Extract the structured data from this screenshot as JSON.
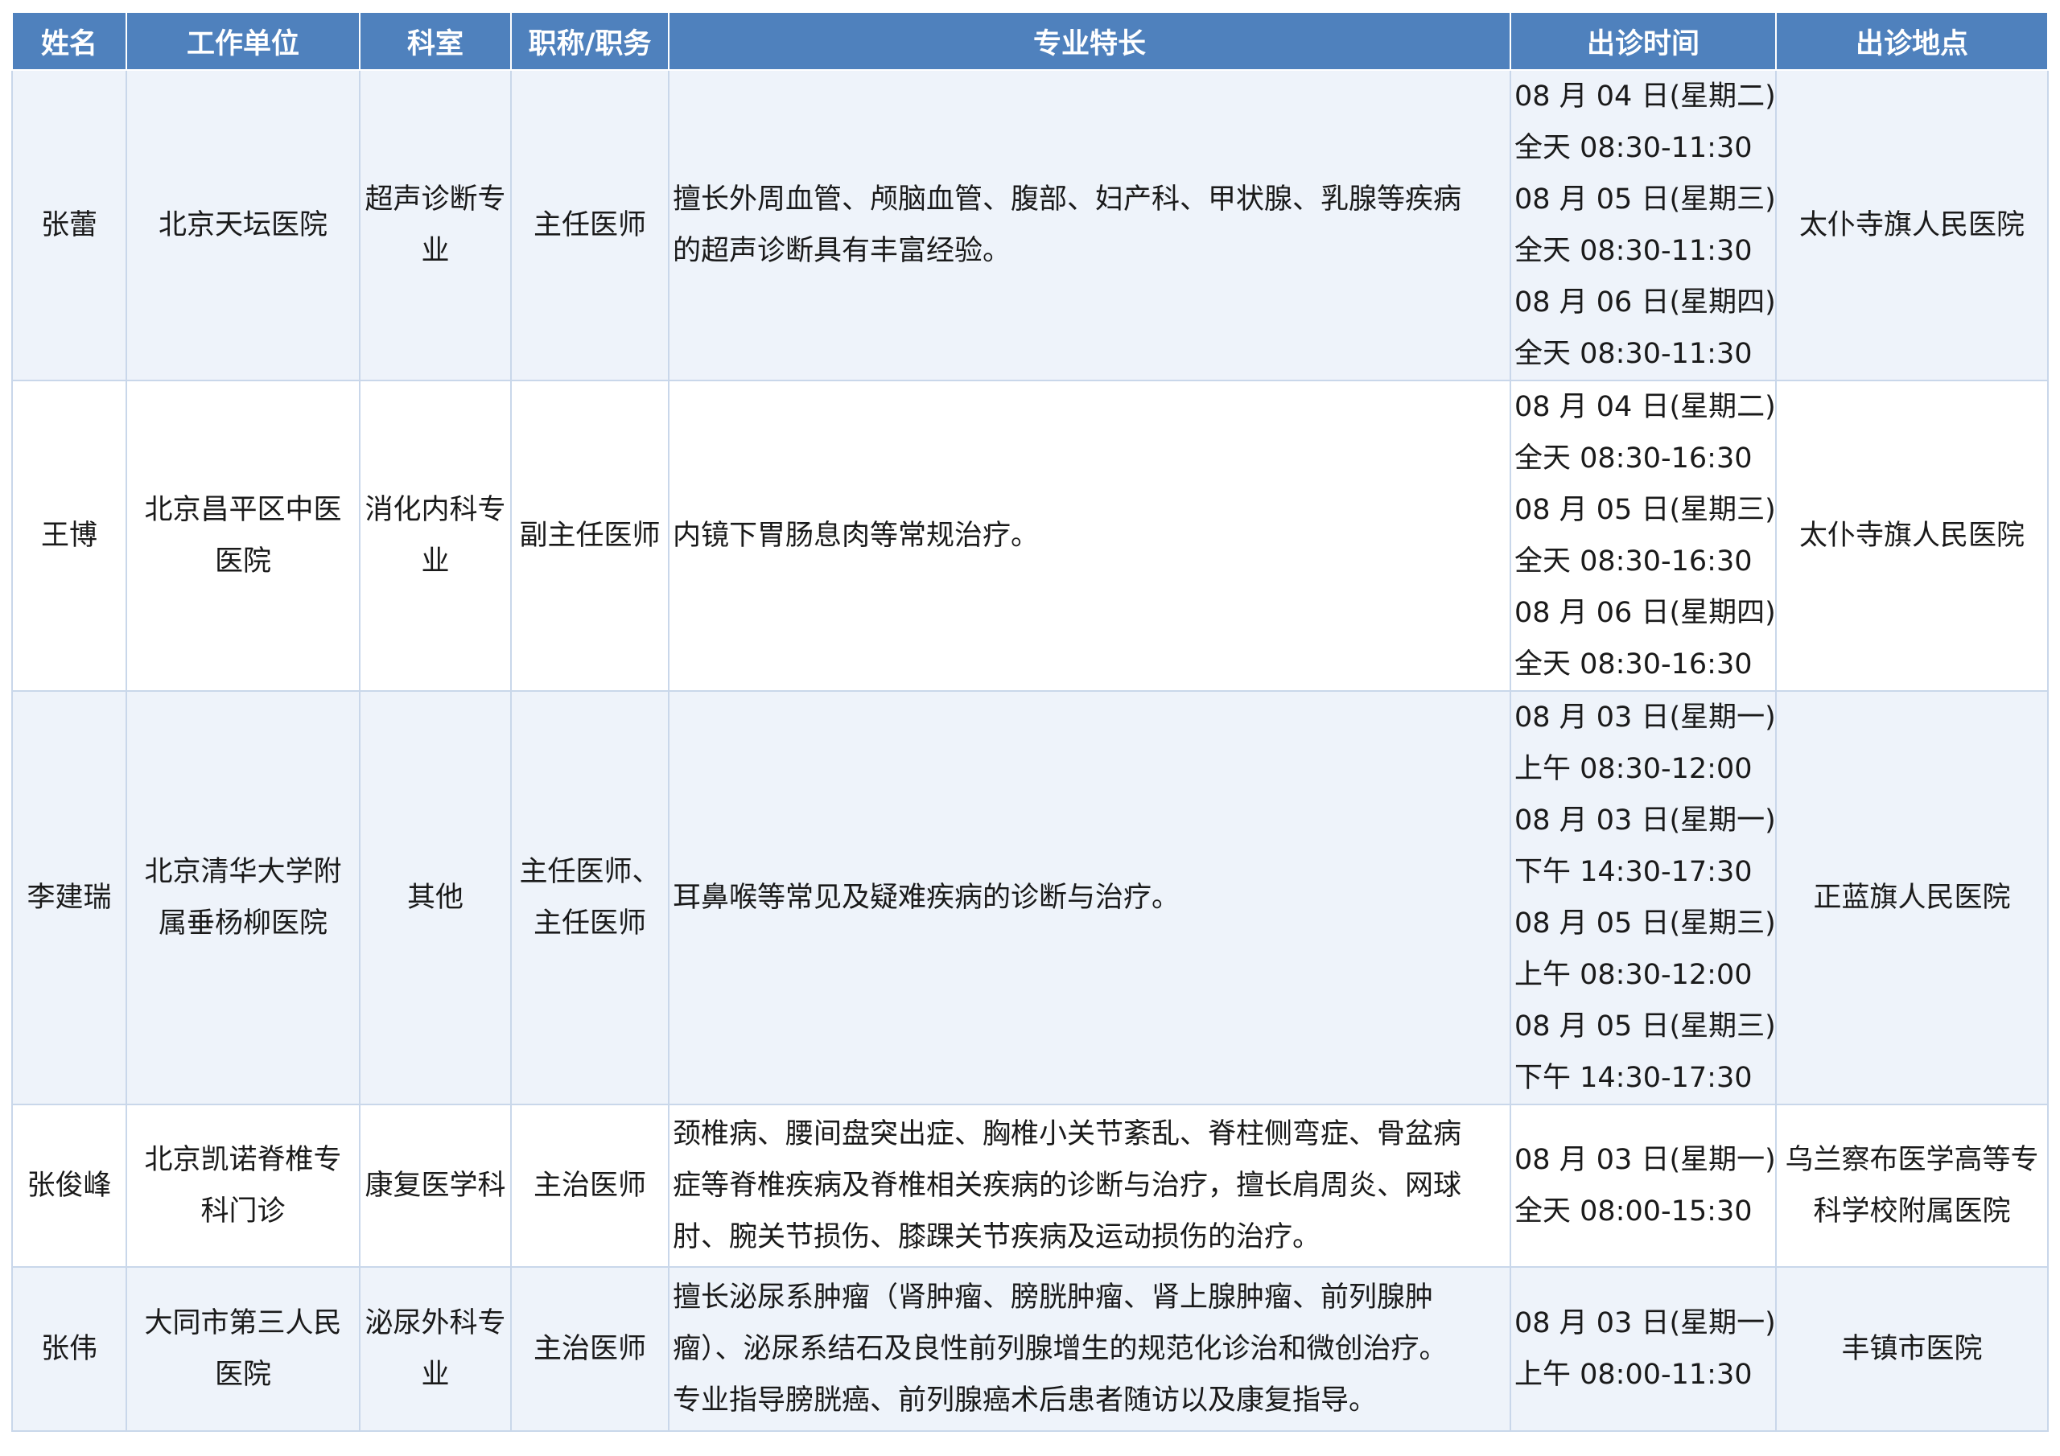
{
  "headers": [
    "姓名",
    "工作单位",
    "科室",
    "职称/职务",
    "专业特长",
    "出诊时间",
    "出诊地点"
  ],
  "rows": [
    {
      "name": "张蕾",
      "unit": [
        "北京天坛医院"
      ],
      "dept": [
        "超声诊断专",
        "业"
      ],
      "title": [
        "主任医师"
      ],
      "specialty": [
        "擅长外周血管、颅脑血管、腹部、妇产科、甲状腺、乳腺等疾病",
        "的超声诊断具有丰富经验。"
      ],
      "times": [
        "08 月 04 日(星期二)",
        "全天 08:30-11:30",
        "08 月 05 日(星期三)",
        "全天 08:30-11:30",
        "08 月 06 日(星期四)",
        "全天 08:30-11:30"
      ],
      "location": [
        "太仆寺旗人民医院"
      ]
    },
    {
      "name": "王博",
      "unit": [
        "北京昌平区中医",
        "医院"
      ],
      "dept": [
        "消化内科专",
        "业"
      ],
      "title": [
        "副主任医师"
      ],
      "specialty": [
        "内镜下胃肠息肉等常规治疗。"
      ],
      "times": [
        "08 月 04 日(星期二)",
        "全天 08:30-16:30",
        "08 月 05 日(星期三)",
        "全天 08:30-16:30",
        "08 月 06 日(星期四)",
        "全天 08:30-16:30"
      ],
      "location": [
        "太仆寺旗人民医院"
      ]
    },
    {
      "name": "李建瑞",
      "unit": [
        "北京清华大学附",
        "属垂杨柳医院"
      ],
      "dept": [
        "其他"
      ],
      "title": [
        "主任医师、",
        "主任医师"
      ],
      "specialty": [
        "耳鼻喉等常见及疑难疾病的诊断与治疗。"
      ],
      "times": [
        "08 月 03 日(星期一)",
        "上午 08:30-12:00",
        "08 月 03 日(星期一)",
        "下午 14:30-17:30",
        "08 月 05 日(星期三)",
        "上午 08:30-12:00",
        "08 月 05 日(星期三)",
        "下午 14:30-17:30"
      ],
      "location": [
        "正蓝旗人民医院"
      ]
    },
    {
      "name": "张俊峰",
      "unit": [
        "北京凯诺脊椎专",
        "科门诊"
      ],
      "dept": [
        "康复医学科"
      ],
      "title": [
        "主治医师"
      ],
      "specialty": [
        "颈椎病、腰间盘突出症、胸椎小关节紊乱、脊柱侧弯症、骨盆病",
        "症等脊椎疾病及脊椎相关疾病的诊断与治疗，擅长肩周炎、网球",
        "肘、腕关节损伤、膝踝关节疾病及运动损伤的治疗。"
      ],
      "times": [
        "08 月 03 日(星期一)",
        "全天 08:00-15:30"
      ],
      "location": [
        "乌兰察布医学高等专",
        "科学校附属医院"
      ]
    },
    {
      "name": "张伟",
      "unit": [
        "大同市第三人民",
        "医院"
      ],
      "dept": [
        "泌尿外科专",
        "业"
      ],
      "title": [
        "主治医师"
      ],
      "specialty": [
        "擅长泌尿系肿瘤（肾肿瘤、膀胱肿瘤、肾上腺肿瘤、前列腺肿",
        "瘤）、泌尿系结石及良性前列腺增生的规范化诊治和微创治疗。",
        "专业指导膀胱癌、前列腺癌术后患者随访以及康复指导。"
      ],
      "times": [
        "08 月 03 日(星期一)",
        "上午 08:00-11:30"
      ],
      "location": [
        "丰镇市医院"
      ]
    }
  ]
}
